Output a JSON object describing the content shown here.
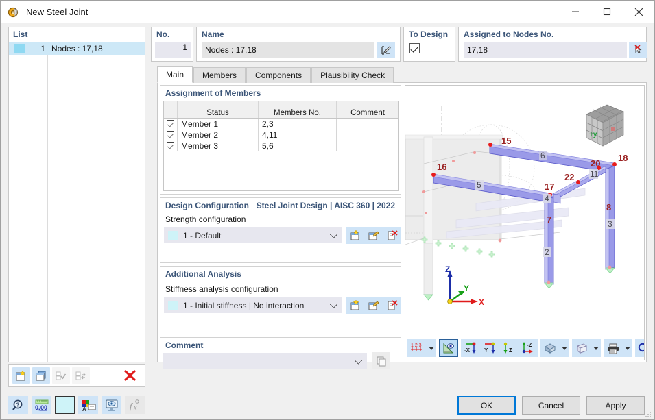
{
  "window": {
    "title": "New Steel Joint",
    "icon": "steel-joint-icon",
    "minimize": "—",
    "maximize": "☐",
    "close": "✕"
  },
  "list_panel": {
    "title": "List",
    "rows": [
      {
        "number": "1",
        "label": "Nodes : 17,18",
        "color": "#8fd9f2"
      }
    ],
    "toolbar": [
      {
        "name": "new-joint-button",
        "icon": "new-document-icon"
      },
      {
        "name": "copy-joint-button",
        "icon": "copy-icon"
      },
      {
        "name": "select-all-button",
        "icon": "check-all-icon"
      },
      {
        "name": "invert-selection-button",
        "icon": "invert-selection-icon"
      },
      {
        "name": "delete-joint-button",
        "icon": "red-x-icon"
      }
    ]
  },
  "header": {
    "no_label": "No.",
    "no_value": "1",
    "name_label": "Name",
    "name_value": "Nodes : 17,18",
    "name_edit_icon": "edit-pencil-icon",
    "to_design_label": "To Design",
    "to_design_checked": true,
    "nodes_label": "Assigned to Nodes No.",
    "nodes_value": "17,18",
    "nodes_pick_icon": "pick-deselect-icon"
  },
  "tabs": [
    {
      "label": "Main",
      "active": true
    },
    {
      "label": "Members",
      "active": false
    },
    {
      "label": "Components",
      "active": false
    },
    {
      "label": "Plausibility Check",
      "active": false
    }
  ],
  "assignment": {
    "title": "Assignment of Members",
    "columns": [
      "",
      "Status",
      "Members No.",
      "Comment"
    ],
    "rows": [
      {
        "checked": true,
        "status": "Member 1",
        "members_no": "2,3",
        "comment": ""
      },
      {
        "checked": true,
        "status": "Member 2",
        "members_no": "4,11",
        "comment": ""
      },
      {
        "checked": true,
        "status": "Member 3",
        "members_no": "5,6",
        "comment": ""
      }
    ]
  },
  "design_configuration": {
    "title": "Design Configuration",
    "standard": "Steel Joint Design | AISC 360 | 2022",
    "field_label": "Strength configuration",
    "value": "1 - Default",
    "swatch_color": "#cef3f8",
    "buttons": [
      {
        "name": "new-configuration-button",
        "icon": "new-config-icon"
      },
      {
        "name": "edit-configuration-button",
        "icon": "edit-config-icon"
      },
      {
        "name": "delete-configuration-button",
        "icon": "delete-config-icon"
      }
    ]
  },
  "additional_analysis": {
    "title": "Additional Analysis",
    "field_label": "Stiffness analysis configuration",
    "value": "1 - Initial stiffness | No interaction",
    "swatch_color": "#cef3f8",
    "buttons": [
      {
        "name": "new-stiffness-config-button",
        "icon": "new-config-icon"
      },
      {
        "name": "edit-stiffness-config-button",
        "icon": "edit-config-icon"
      },
      {
        "name": "delete-stiffness-config-button",
        "icon": "delete-config-icon"
      }
    ]
  },
  "comment": {
    "title": "Comment",
    "value": "",
    "placeholder": "",
    "copy_icon": "copy-pages-icon"
  },
  "viewport": {
    "navcube_label_y": "+y",
    "axes": {
      "x": "X",
      "y": "Y",
      "z": "Z"
    },
    "member_labels": [
      "2",
      "3",
      "4",
      "5",
      "6",
      "7",
      "8",
      "11"
    ],
    "node_labels": [
      "15",
      "16",
      "17",
      "18",
      "20",
      "22"
    ],
    "toolbar": [
      {
        "name": "numbering-button",
        "icon": "numbering-123-icon",
        "has_dropdown": true
      },
      {
        "name": "visibility-button",
        "icon": "render-eye-icon",
        "selected": true
      },
      {
        "name": "view-minus-x-button",
        "icon": "view-x-icon",
        "label": "-X"
      },
      {
        "name": "view-y-button",
        "icon": "view-y-icon",
        "label": "Y"
      },
      {
        "name": "view-z-button",
        "icon": "view-z-icon",
        "label": "Z"
      },
      {
        "name": "view-minus-z-button",
        "icon": "view-minus-z-icon",
        "label": "-Z"
      },
      {
        "name": "render-mode-button",
        "icon": "solid-model-icon",
        "has_dropdown": true
      },
      {
        "name": "wireframe-button",
        "icon": "wireframe-cube-icon",
        "has_dropdown": true
      },
      {
        "name": "print-button",
        "icon": "printer-icon",
        "has_dropdown": true
      },
      {
        "name": "reset-zoom-button",
        "icon": "zoom-reset-icon"
      }
    ]
  },
  "bottom_bar": {
    "tools": [
      {
        "name": "help-button",
        "icon": "help-magnifier-icon"
      },
      {
        "name": "units-button",
        "icon": "units-decimal-icon"
      },
      {
        "name": "color-swatch-button",
        "icon": "color-swatch-icon"
      },
      {
        "name": "display-properties-button",
        "icon": "display-properties-icon"
      },
      {
        "name": "view-settings-button",
        "icon": "view-settings-icon"
      },
      {
        "name": "formula-button",
        "icon": "formula-fx-icon"
      }
    ],
    "buttons": [
      {
        "label": "OK",
        "name": "ok-button",
        "primary": true
      },
      {
        "label": "Cancel",
        "name": "cancel-button",
        "primary": false
      },
      {
        "label": "Apply",
        "name": "apply-button",
        "primary": false
      }
    ]
  }
}
